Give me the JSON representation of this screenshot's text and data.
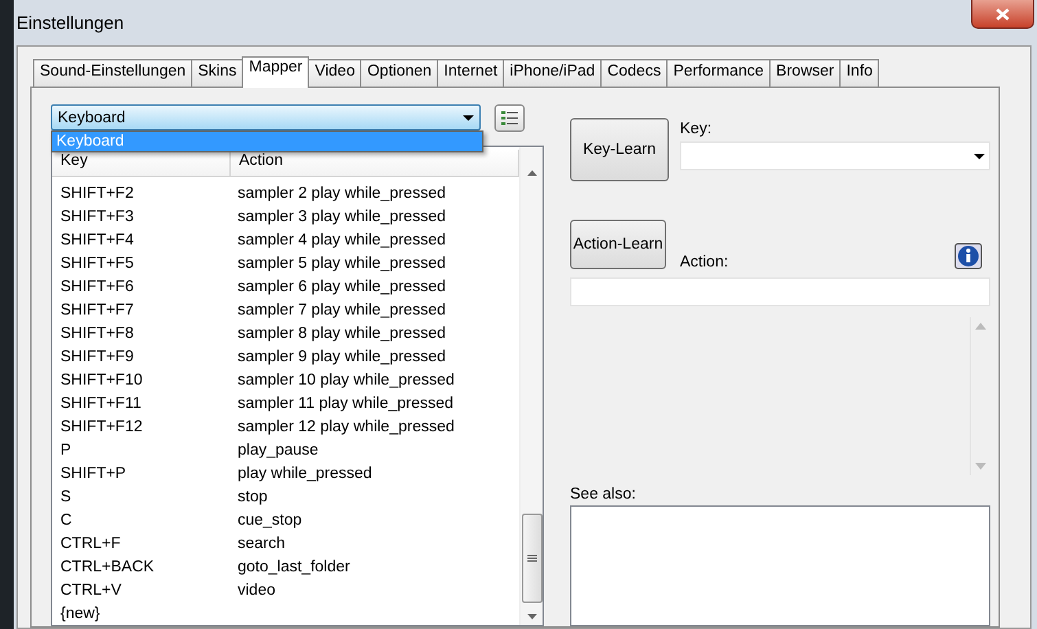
{
  "window": {
    "title": "Einstellungen"
  },
  "tabs": [
    {
      "label": "Sound-Einstellungen",
      "selected": false
    },
    {
      "label": "Skins",
      "selected": false
    },
    {
      "label": "Mapper",
      "selected": true
    },
    {
      "label": "Video",
      "selected": false
    },
    {
      "label": "Optionen",
      "selected": false
    },
    {
      "label": "Internet",
      "selected": false
    },
    {
      "label": "iPhone/iPad",
      "selected": false
    },
    {
      "label": "Codecs",
      "selected": false
    },
    {
      "label": "Performance",
      "selected": false
    },
    {
      "label": "Browser",
      "selected": false
    },
    {
      "label": "Info",
      "selected": false
    }
  ],
  "mapper": {
    "device_select": {
      "value": "Keyboard",
      "expanded": true,
      "options": [
        {
          "label": "Keyboard",
          "selected": true
        }
      ]
    },
    "table": {
      "columns": [
        "Key",
        "Action"
      ],
      "rows": [
        {
          "key": "SHIFT+F2",
          "action": "sampler 2 play while_pressed"
        },
        {
          "key": "SHIFT+F3",
          "action": "sampler 3 play while_pressed"
        },
        {
          "key": "SHIFT+F4",
          "action": "sampler 4 play while_pressed"
        },
        {
          "key": "SHIFT+F5",
          "action": "sampler 5 play while_pressed"
        },
        {
          "key": "SHIFT+F6",
          "action": "sampler 6 play while_pressed"
        },
        {
          "key": "SHIFT+F7",
          "action": "sampler 7 play while_pressed"
        },
        {
          "key": "SHIFT+F8",
          "action": "sampler 8 play while_pressed"
        },
        {
          "key": "SHIFT+F9",
          "action": "sampler 9 play while_pressed"
        },
        {
          "key": "SHIFT+F10",
          "action": "sampler 10 play while_pressed"
        },
        {
          "key": "SHIFT+F11",
          "action": "sampler 11 play while_pressed"
        },
        {
          "key": "SHIFT+F12",
          "action": "sampler 12 play while_pressed"
        },
        {
          "key": "P",
          "action": "play_pause"
        },
        {
          "key": "SHIFT+P",
          "action": "play while_pressed"
        },
        {
          "key": "S",
          "action": "stop"
        },
        {
          "key": "C",
          "action": "cue_stop"
        },
        {
          "key": "CTRL+F",
          "action": "search"
        },
        {
          "key": "CTRL+BACK",
          "action": "goto_last_folder"
        },
        {
          "key": "CTRL+V",
          "action": "video"
        },
        {
          "key": "{new}",
          "action": ""
        }
      ]
    },
    "key_learn_button": "Key-Learn",
    "key_label": "Key:",
    "action_learn_button": "Action-Learn",
    "action_label": "Action:",
    "see_also_label": "See also:"
  }
}
